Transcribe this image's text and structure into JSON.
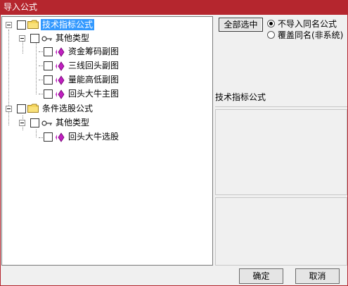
{
  "window": {
    "title": "导入公式"
  },
  "tree": {
    "root1": {
      "label": "技术指标公式",
      "child": {
        "label": "其他类型",
        "items": [
          "资金筹码副图",
          "三线回头副图",
          "量能高低副图",
          "回头大牛主图"
        ]
      }
    },
    "root2": {
      "label": "条件选股公式",
      "child": {
        "label": "其他类型",
        "items": [
          "回头大牛选股"
        ]
      }
    }
  },
  "options": {
    "select_all_label": "全部选中",
    "radio_options": [
      {
        "label": "不导入同名公式",
        "checked": true
      },
      {
        "label": "覆盖同名(非系统)",
        "checked": false
      }
    ]
  },
  "info": {
    "title": "技术指标公式"
  },
  "footer": {
    "ok_label": "确定",
    "cancel_label": "取消"
  },
  "colors": {
    "titlebar": "#b5262e",
    "selection": "#3399ff",
    "formula_icon": "#c020c0"
  }
}
